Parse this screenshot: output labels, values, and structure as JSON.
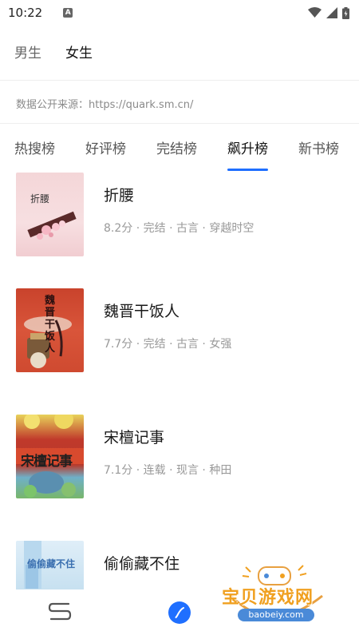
{
  "status_bar": {
    "time": "10:22",
    "notification_badge": "A"
  },
  "gender_tabs": [
    {
      "label": "男生",
      "active": false
    },
    {
      "label": "女生",
      "active": true
    }
  ],
  "source_note": "数据公开来源：https://quark.sm.cn/",
  "rank_tabs": [
    {
      "label": "热搜榜",
      "active": false
    },
    {
      "label": "好评榜",
      "active": false
    },
    {
      "label": "完结榜",
      "active": false
    },
    {
      "label": "飙升榜",
      "active": true
    },
    {
      "label": "新书榜",
      "active": false
    }
  ],
  "books": [
    {
      "title": "折腰",
      "meta": "8.2分 · 完结 · 古言 · 穿越时空",
      "cover_text": "折腰"
    },
    {
      "title": "魏晋干饭人",
      "meta": "7.7分 · 完结 · 古言 · 女强",
      "cover_text": "魏晋干饭人"
    },
    {
      "title": "宋檀记事",
      "meta": "7.1分 · 连载 · 现言 · 种田",
      "cover_text": "宋檀记事"
    },
    {
      "title": "偷偷藏不住",
      "meta": "",
      "cover_text": "偷偷藏不住"
    }
  ],
  "bottom_nav": [
    {
      "icon": "bookshelf-icon"
    },
    {
      "icon": "compass-icon"
    }
  ],
  "watermark": {
    "text": "宝贝游戏网",
    "url": "baobeiy.com"
  },
  "colors": {
    "accent": "#1f6fff",
    "meta_gray": "#999999",
    "watermark_orange": "#f0a020"
  }
}
